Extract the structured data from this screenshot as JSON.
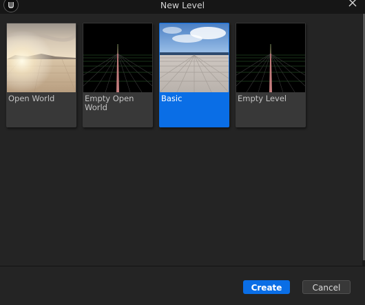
{
  "window": {
    "title": "New Level"
  },
  "templates": [
    {
      "label": "Open World",
      "selected": false
    },
    {
      "label": "Empty Open World",
      "selected": false
    },
    {
      "label": "Basic",
      "selected": true
    },
    {
      "label": "Empty Level",
      "selected": false
    }
  ],
  "footer": {
    "create_label": "Create",
    "cancel_label": "Cancel"
  },
  "colors": {
    "accent": "#0a6ee6",
    "background": "#242424",
    "card": "#383838"
  },
  "icons": {
    "logo": "unreal-engine-logo-icon",
    "close": "close-icon"
  }
}
